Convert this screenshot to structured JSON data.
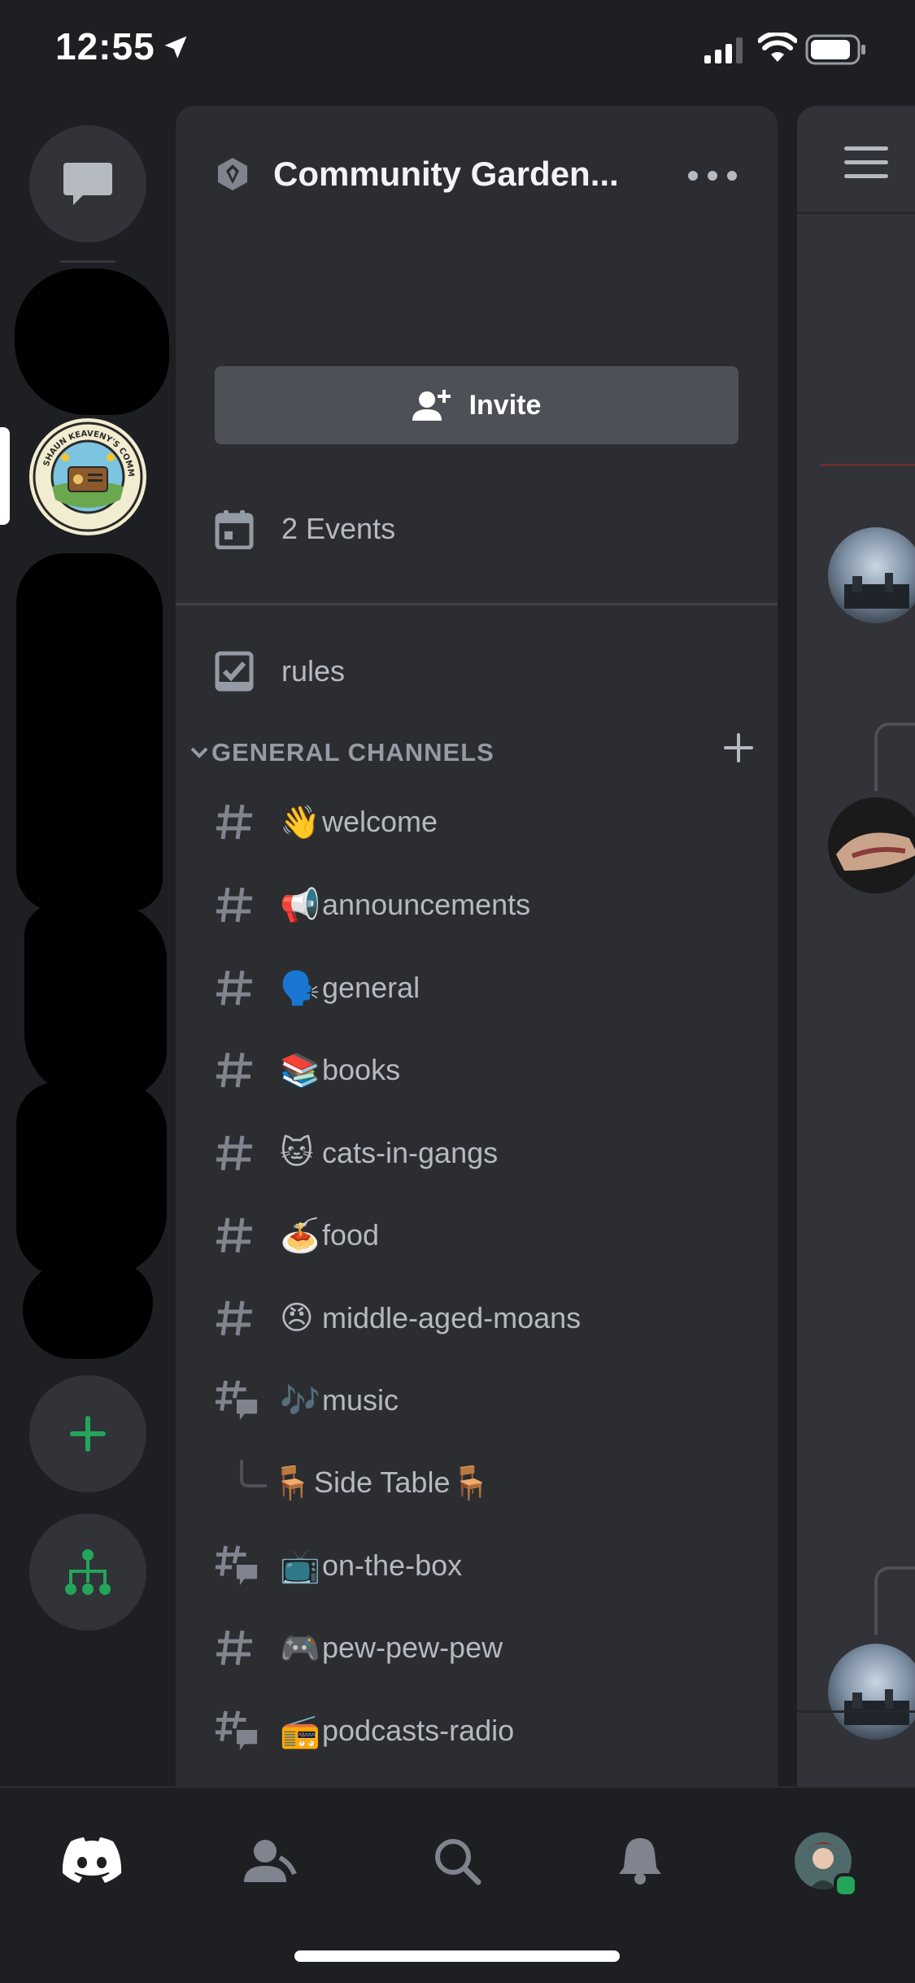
{
  "status_bar": {
    "time": "12:55"
  },
  "rail": {
    "dm_icon": "chat-bubble-icon",
    "add_server_icon": "plus-icon",
    "discover_icon": "hub-icon",
    "server_logo_text": "SHAUN KEAVENY'S COMMUNITY GARDEN RADIO"
  },
  "server": {
    "name": "Community Garden...",
    "invite_label": "Invite",
    "events_label": "2 Events"
  },
  "rules_channel": {
    "name": "rules"
  },
  "category": {
    "label": "GENERAL CHANNELS"
  },
  "channels": [
    {
      "emoji": "👋",
      "name": "welcome",
      "type": "text"
    },
    {
      "emoji": "📢",
      "name": "announcements",
      "type": "text"
    },
    {
      "emoji": "🗣️",
      "name": "general",
      "type": "text"
    },
    {
      "emoji": "📚",
      "name": "books",
      "type": "text"
    },
    {
      "emoji": "🐱",
      "name": "cats-in-gangs",
      "type": "text"
    },
    {
      "emoji": "🍝",
      "name": "food",
      "type": "text"
    },
    {
      "emoji": "😠",
      "name": "middle-aged-moans",
      "type": "text"
    },
    {
      "emoji": "🎶",
      "name": "music",
      "type": "forum"
    },
    {
      "emoji": "🪑",
      "name": "Side Table",
      "emoji_after": "🪑",
      "type": "thread"
    },
    {
      "emoji": "📺",
      "name": "on-the-box",
      "type": "forum"
    },
    {
      "emoji": "🎮",
      "name": "pew-pew-pew",
      "type": "text"
    },
    {
      "emoji": "📻",
      "name": "podcasts-radio",
      "type": "forum"
    }
  ],
  "tabs": [
    {
      "name": "home",
      "icon": "discord-icon"
    },
    {
      "name": "friends",
      "icon": "friends-icon"
    },
    {
      "name": "search",
      "icon": "search-icon"
    },
    {
      "name": "notifications",
      "icon": "bell-icon"
    },
    {
      "name": "profile",
      "icon": "avatar"
    }
  ],
  "colors": {
    "background": "#1e1f22",
    "panel": "#2b2d31",
    "accent_green": "#23a55a",
    "text_muted": "#b5bac1"
  }
}
